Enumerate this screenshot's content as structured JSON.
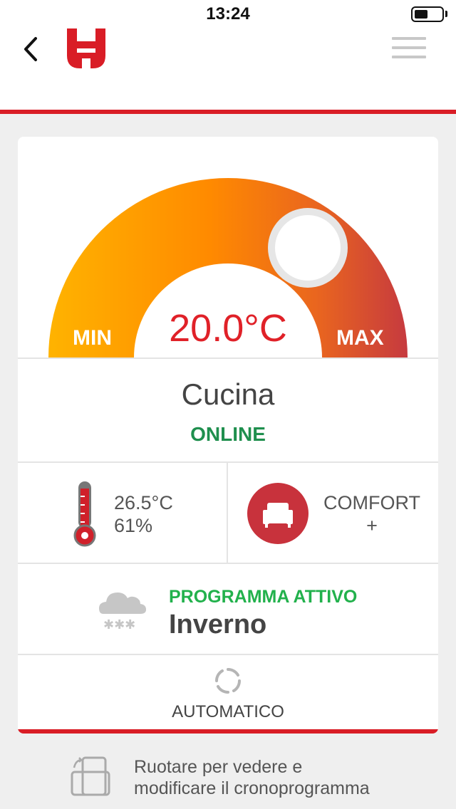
{
  "status_bar": {
    "time": "13:24"
  },
  "nav": {
    "back_icon": "chevron-left-icon",
    "logo": "wurth-logo",
    "menu_icon": "hamburger-icon"
  },
  "thermostat": {
    "min_label": "MIN",
    "max_label": "MAX",
    "setpoint": "20.0°C",
    "gauge_colors": [
      "#ffb300",
      "#ff8a00",
      "#c63a3f"
    ]
  },
  "room": {
    "name": "Cucina",
    "status": "ONLINE",
    "status_color": "#1f8f4e"
  },
  "sensor": {
    "icon": "thermometer-icon",
    "temperature": "26.5°C",
    "humidity": "61%"
  },
  "mode": {
    "icon": "armchair-icon",
    "line1": "COMFORT",
    "line2": "+"
  },
  "program": {
    "icon": "snow-cloud-icon",
    "label": "PROGRAMMA ATTIVO",
    "name": "Inverno"
  },
  "operation": {
    "icon": "refresh-icon",
    "label": "AUTOMATICO"
  },
  "hint": {
    "icon": "rotate-device-icon",
    "line1": "Ruotare per vedere e",
    "line2": "modificare il cronoprogramma"
  },
  "colors": {
    "accent": "#d91d26",
    "online": "#1f8f4e",
    "program": "#22b14c"
  }
}
